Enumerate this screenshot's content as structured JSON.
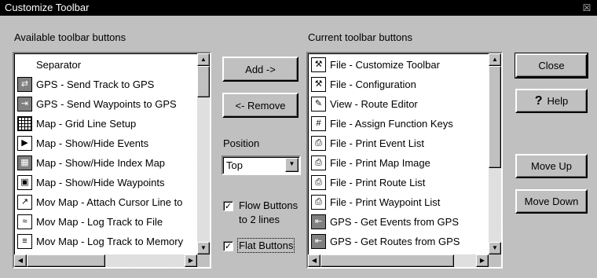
{
  "window": {
    "title": "Customize Toolbar",
    "close_glyph": "☒"
  },
  "available": {
    "label": "Available toolbar buttons",
    "items": [
      {
        "label": "Separator",
        "icon": ""
      },
      {
        "label": "GPS - Send Track to GPS",
        "icon": "⇄"
      },
      {
        "label": "GPS - Send Waypoints to GPS",
        "icon": "⇥"
      },
      {
        "label": "Map - Grid Line Setup",
        "icon": ""
      },
      {
        "label": "Map - Show/Hide Events",
        "icon": "▶"
      },
      {
        "label": "Map - Show/Hide Index Map",
        "icon": "▦"
      },
      {
        "label": "Map - Show/Hide Waypoints",
        "icon": "▣"
      },
      {
        "label": "Mov Map - Attach Cursor Line to",
        "icon": "↗"
      },
      {
        "label": "Mov Map - Log Track to File",
        "icon": "≈"
      },
      {
        "label": "Mov Map - Log Track to Memory",
        "icon": "≡"
      }
    ]
  },
  "current": {
    "label": "Current toolbar buttons",
    "items": [
      {
        "label": "File - Customize Toolbar",
        "icon": "⚒"
      },
      {
        "label": "File - Configuration",
        "icon": "⚒"
      },
      {
        "label": "View - Route Editor",
        "icon": "✎"
      },
      {
        "label": "File - Assign Function Keys",
        "icon": "#"
      },
      {
        "label": "File - Print Event List",
        "icon": "⎙"
      },
      {
        "label": "File - Print Map Image",
        "icon": "⎙"
      },
      {
        "label": "File - Print Route List",
        "icon": "⎙"
      },
      {
        "label": "File - Print Waypoint List",
        "icon": "⎙"
      },
      {
        "label": "GPS - Get Events from GPS",
        "icon": "⇤"
      },
      {
        "label": "GPS - Get Routes from GPS",
        "icon": "⇤"
      }
    ]
  },
  "buttons": {
    "add": "Add ->",
    "remove": "<- Remove",
    "close": "Close",
    "help": "Help",
    "help_glyph": "?",
    "move_up": "Move Up",
    "move_down": "Move Down"
  },
  "position": {
    "label": "Position",
    "value": "Top"
  },
  "options": {
    "flow_label_1": "Flow Buttons",
    "flow_label_2": "to 2 lines",
    "flow_checked": true,
    "flat_label": "Flat Buttons",
    "flat_checked": true
  },
  "scroll_glyphs": {
    "up": "▲",
    "down": "▼",
    "left": "◀",
    "right": "▶"
  }
}
